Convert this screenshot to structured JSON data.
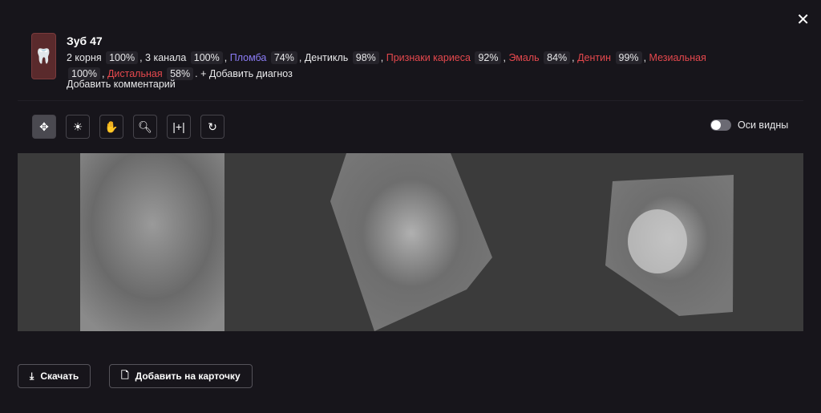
{
  "tooth": {
    "title": "Зуб 47",
    "icon": "tooth-icon"
  },
  "diagnoses": [
    {
      "label": "2 корня",
      "pct": "100%",
      "color": "default"
    },
    {
      "label": "3 канала",
      "pct": "100%",
      "color": "default"
    },
    {
      "label": "Пломба",
      "pct": "74%",
      "color": "purple"
    },
    {
      "label": "Дентикль",
      "pct": "98%",
      "color": "default"
    },
    {
      "label": "Признаки кариеса",
      "pct": "92%",
      "color": "red"
    },
    {
      "label": "Эмаль",
      "pct": "84%",
      "color": "red"
    },
    {
      "label": "Дентин",
      "pct": "99%",
      "color": "red"
    },
    {
      "label": "Мезиальная",
      "pct": "100%",
      "color": "red"
    },
    {
      "label": "Дистальная",
      "pct": "58%",
      "color": "red"
    }
  ],
  "add_diagnosis": "+ Добавить диагноз",
  "add_comment": "Добавить комментарий",
  "toolbar": {
    "tools": [
      "move",
      "brightness-contrast",
      "pan-hand",
      "zoom",
      "axis",
      "rotate"
    ]
  },
  "axes_toggle": {
    "label": "Оси видны",
    "on": false
  },
  "buttons": {
    "download": "Скачать",
    "add_to_card": "Добавить на карточку"
  },
  "colors": {
    "red": "#e5484d",
    "purple": "#8b7cf6",
    "background": "#17151b"
  }
}
